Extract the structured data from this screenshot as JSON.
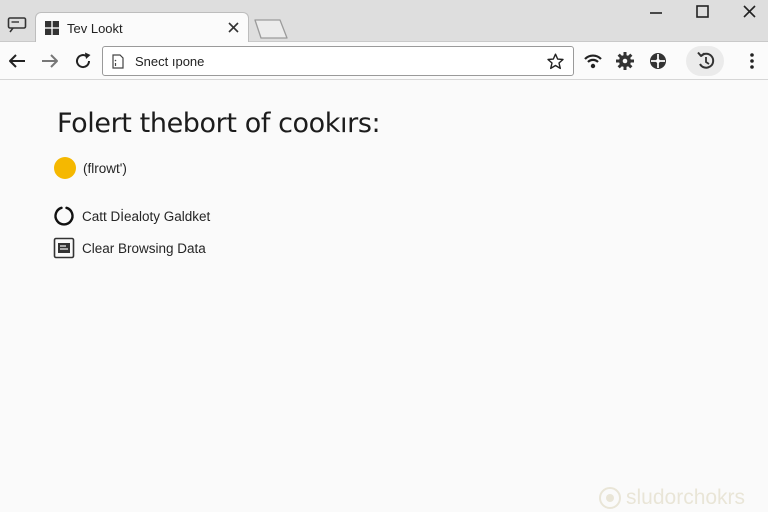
{
  "tab": {
    "title": "Tev Lookt"
  },
  "omnibox": {
    "value": "Snect ıpone"
  },
  "page": {
    "title": "Folert thebort of cookırs:",
    "status_label": "(flrowt')",
    "cart_label": "Catt Dİealoty Galdket",
    "clear_label": "Clear Browsing Data"
  },
  "watermark": {
    "text": "sludorchokrs"
  },
  "colors": {
    "status_dot": "#f5b800",
    "tabstrip": "#dedede",
    "page_bg": "#fafafa"
  }
}
